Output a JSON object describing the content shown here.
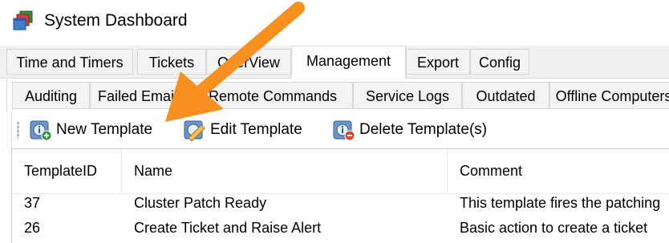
{
  "window": {
    "title": "System Dashboard",
    "app_icon": "stacked-windows-icon"
  },
  "tabs_primary": [
    {
      "label": "Time and Timers"
    },
    {
      "label": "Tickets"
    },
    {
      "label": "OverView"
    },
    {
      "label": "Management",
      "active": true
    },
    {
      "label": "Export"
    },
    {
      "label": "Config"
    }
  ],
  "tabs_secondary": [
    {
      "label": "Auditing"
    },
    {
      "label": "Failed Emails"
    },
    {
      "label": "Remote Commands"
    },
    {
      "label": "Service Logs"
    },
    {
      "label": "Outdated"
    },
    {
      "label": "Offline Computers"
    }
  ],
  "toolbar": {
    "new_label": "New Template",
    "edit_label": "Edit Template",
    "delete_label": "Delete Template(s)"
  },
  "table": {
    "columns": [
      "TemplateID",
      "Name",
      "Comment"
    ],
    "rows": [
      [
        "37",
        "Cluster Patch Ready",
        "This template fires the patching"
      ],
      [
        "26",
        "Create Ticket and Raise Alert",
        "Basic action to create a ticket"
      ]
    ]
  },
  "annotation": {
    "color": "#f7901e",
    "icon": "orange-arrow-pointing-to-new-template"
  }
}
